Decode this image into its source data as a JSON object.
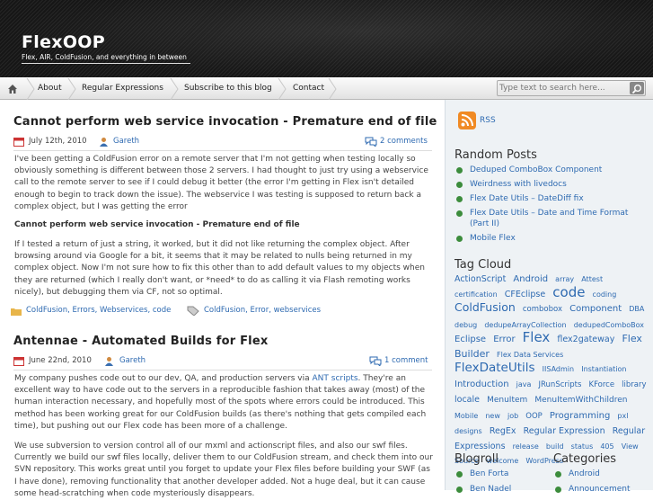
{
  "site": {
    "title": "FlexOOP",
    "description": "Flex, AIR, ColdFusion, and everything in between"
  },
  "nav": {
    "items": [
      "About",
      "Regular Expressions",
      "Subscribe to this blog",
      "Contact"
    ]
  },
  "search": {
    "placeholder": "Type text to search here..."
  },
  "posts": [
    {
      "title": "Cannot perform web service invocation - Premature end of file",
      "date": "July 12th, 2010",
      "author": "Gareth",
      "comments": "2 comments",
      "paragraphs": [
        "I've been getting a ColdFusion error on a remote server that I'm not getting when testing locally so obviously something is different between those 2 servers. I had thought to just try using a webservice call to the remote server to see if I could debug it better (the error I'm getting in Flex isn't detailed enough to begin to track down the issue). The webservice I was testing is supposed to return back a complex object, but I was getting the error"
      ],
      "subheading": "Cannot perform web service invocation - Premature end of file",
      "paragraph2": "If I tested a return of just a string, it worked, but it did not like returning the complex object. After browsing around via Google for a bit, it seems that it may be related to nulls being returned in my complex object. Now I'm not sure how to fix this other than to add default values to my objects when they are returned (which I really don't want, or *need* to do as calling it via Flash remoting works nicely), but debugging them via CF, not so optimal.",
      "categories": "ColdFusion, Errors, Webservices, code",
      "tags": "ColdFusion, Error, webservices"
    },
    {
      "title": "Antennae - Automated Builds for Flex",
      "date": "June 22nd, 2010",
      "author": "Gareth",
      "comments": "1 comment",
      "p1_before": "My company pushes code out to our dev, QA, and production servers via ",
      "p1_link": "ANT scripts",
      "p1_after": ". They're an excellent way to have code out to the servers in a reproducible fashion that takes away (most) of the human interaction necessary, and hopefully most of the spots where errors could be introduced. This method has been working great for our ColdFusion builds (as there's nothing that gets compiled each time), but pushing out our Flex code has been more of a challenge.",
      "p2": "We use subversion to version control all of our mxml and actionscript files, and also our swf files. Currently we build our swf files locally, deliver them to our ColdFusion stream, and check them into our SVN repository. This works great until you forget to update your Flex files before building your SWF (as I have done), removing functionality that another developer added. Not a huge deal, but it can cause some head-scratching when code mysteriously disappears."
    }
  ],
  "sidebar": {
    "rss": "RSS",
    "random_posts_title": "Random Posts",
    "random_posts": [
      "Deduped ComboBox Component",
      "Weirdness with livedocs",
      "Flex Date Utils – DateDiff fix",
      "Flex Date Utils – Date and Time Format (Part II)",
      "Mobile Flex"
    ],
    "tag_cloud_title": "Tag Cloud",
    "tags": [
      {
        "t": "ActionScript",
        "s": 9.5
      },
      {
        "t": "Android",
        "s": 10
      },
      {
        "t": "array",
        "s": 8
      },
      {
        "t": "Attest",
        "s": 8
      },
      {
        "t": "certification",
        "s": 8
      },
      {
        "t": "CFEclipse",
        "s": 9.5
      },
      {
        "t": "code",
        "s": 15
      },
      {
        "t": "coding",
        "s": 8
      },
      {
        "t": "ColdFusion",
        "s": 12.5
      },
      {
        "t": "combobox",
        "s": 8.5
      },
      {
        "t": "Component",
        "s": 10
      },
      {
        "t": "DBA",
        "s": 8
      },
      {
        "t": "debug",
        "s": 8
      },
      {
        "t": "dedupeArrayCollection",
        "s": 8
      },
      {
        "t": "dedupedComboBox",
        "s": 8
      },
      {
        "t": "Eclipse",
        "s": 10
      },
      {
        "t": "Error",
        "s": 10
      },
      {
        "t": "Flex",
        "s": 15
      },
      {
        "t": "flex2gateway",
        "s": 9.5
      },
      {
        "t": "Flex",
        "s": 11
      },
      {
        "t": "Builder",
        "s": 11
      },
      {
        "t": "Flex Data Services",
        "s": 8
      },
      {
        "t": "FlexDateUtils",
        "s": 13.5
      },
      {
        "t": "IISAdmin",
        "s": 8
      },
      {
        "t": "Instantiation",
        "s": 8
      },
      {
        "t": "Introduction",
        "s": 10
      },
      {
        "t": "java",
        "s": 8
      },
      {
        "t": "JRunScripts",
        "s": 8.5
      },
      {
        "t": "KForce",
        "s": 8.5
      },
      {
        "t": "library",
        "s": 8.5
      },
      {
        "t": "locale",
        "s": 9.5
      },
      {
        "t": "MenuItem",
        "s": 9
      },
      {
        "t": "MenuItemWithChildren",
        "s": 9
      },
      {
        "t": "Mobile",
        "s": 8
      },
      {
        "t": "new",
        "s": 8
      },
      {
        "t": "job",
        "s": 8
      },
      {
        "t": "OOP",
        "s": 8.5
      },
      {
        "t": "Programming",
        "s": 10
      },
      {
        "t": "pxl",
        "s": 8
      },
      {
        "t": "designs",
        "s": 8
      },
      {
        "t": "RegEx",
        "s": 9.5
      },
      {
        "t": "Regular Expression",
        "s": 9.5
      },
      {
        "t": "Regular",
        "s": 9.5
      },
      {
        "t": "Expressions",
        "s": 9.5
      },
      {
        "t": "release",
        "s": 8
      },
      {
        "t": "build",
        "s": 8
      },
      {
        "t": "status",
        "s": 8
      },
      {
        "t": "405",
        "s": 8
      },
      {
        "t": "View",
        "s": 8
      },
      {
        "t": "Source",
        "s": 8
      },
      {
        "t": "welcome",
        "s": 8
      },
      {
        "t": "WordPress",
        "s": 8
      }
    ],
    "blogroll_title": "Blogroll",
    "blogroll": [
      "Ben Forta",
      "Ben Nadel"
    ],
    "categories_title": "Categories",
    "categories": [
      "Android",
      "Announcement"
    ]
  },
  "colors": {
    "link": "#2e6ab1",
    "bullet": "#3c8c3c",
    "sidebar_bg": "#eef2f5",
    "header_bg": "#1c1c1c"
  }
}
